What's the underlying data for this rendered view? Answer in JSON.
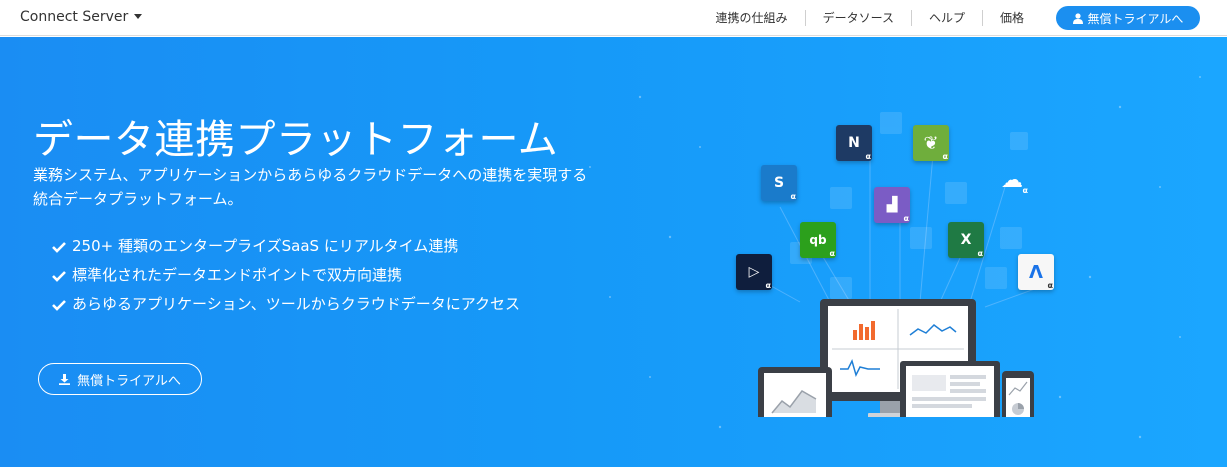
{
  "header": {
    "brand": "Connect Server",
    "nav": [
      "連携の仕組み",
      "データソース",
      "ヘルプ",
      "価格"
    ],
    "cta_label": "無償トライアルへ"
  },
  "hero": {
    "title": "データ連携プラットフォーム",
    "subtitle": "業務システム、アプリケーションからあらゆるクラウドデータへの連携を実現する統合データプラットフォーム。",
    "features": [
      "250+ 種類のエンタープライズSaaS にリアルタイム連携",
      "標準化されたデータエンドポイントで双方向連携",
      "あらゆるアプリケーション、ツールからクラウドデータにアクセス"
    ],
    "cta_label": "無償トライアルへ"
  },
  "illustration": {
    "apps": [
      {
        "name": "netsuite",
        "letter": "N",
        "badge": "α",
        "color": "#1e3a64"
      },
      {
        "name": "mongodb",
        "letter": "❦",
        "badge": "α",
        "color": "#6fae3c"
      },
      {
        "name": "sharepoint",
        "letter": "S",
        "badge": "α",
        "color": "#1a7bcb"
      },
      {
        "name": "salesforce",
        "letter": "☁",
        "badge": "α",
        "color": "#ffffff"
      },
      {
        "name": "marketo",
        "letter": "▟",
        "badge": "α",
        "color": "#7b5cc5"
      },
      {
        "name": "quickbooks",
        "letter": "qb",
        "badge": "α",
        "color": "#2ca01c"
      },
      {
        "name": "excel",
        "letter": "X",
        "badge": "α",
        "color": "#1f7a44"
      },
      {
        "name": "dynamics",
        "letter": "▷",
        "badge": "α",
        "color": "#0f1e3d"
      },
      {
        "name": "adwords",
        "letter": "Λ",
        "badge": "α",
        "color": "#f7f7f7"
      }
    ],
    "colors": {
      "bar": "#f26a2e",
      "line": "#1f7fd6"
    }
  }
}
